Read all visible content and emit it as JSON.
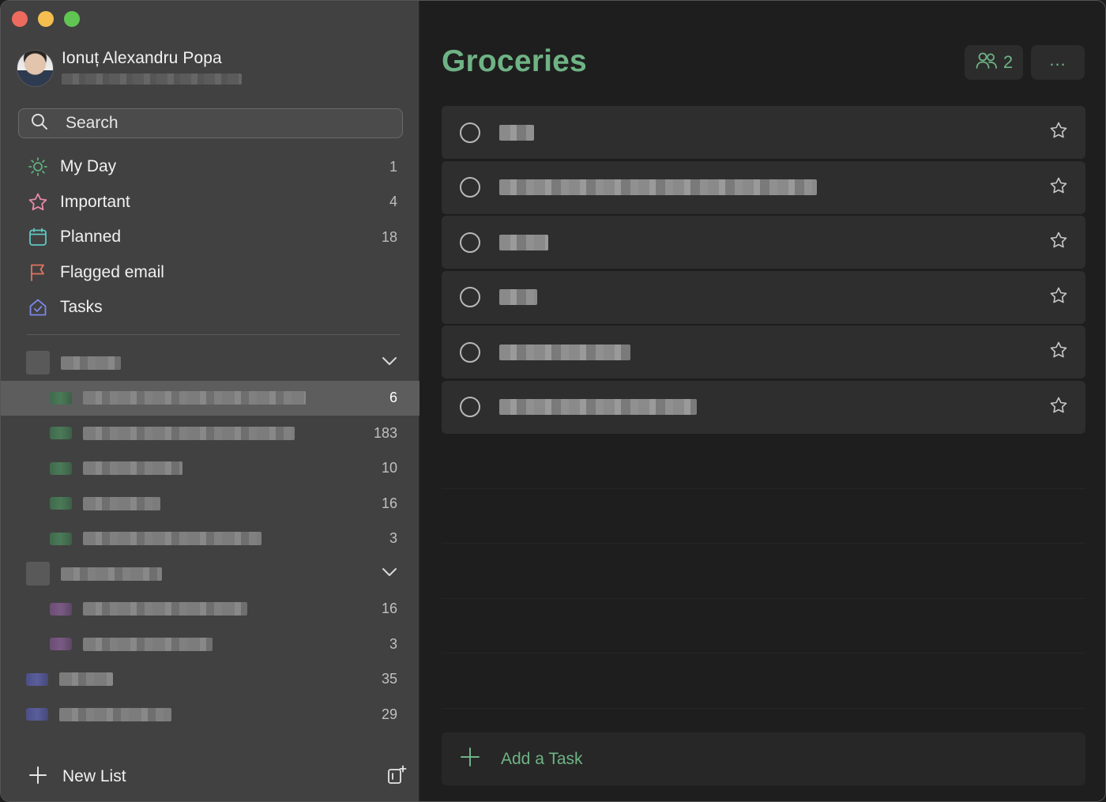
{
  "window": {
    "controls": [
      "close",
      "minimize",
      "maximize"
    ]
  },
  "profile": {
    "name": "Ionuț Alexandru Popa"
  },
  "search": {
    "placeholder": "Search"
  },
  "nav": [
    {
      "label": "My Day",
      "count": "1",
      "icon": "sun-icon",
      "color": "#5fb07f"
    },
    {
      "label": "Important",
      "count": "4",
      "icon": "star-icon",
      "color": "#e88aa8"
    },
    {
      "label": "Planned",
      "count": "18",
      "icon": "calendar-icon",
      "color": "#5fc7c0"
    },
    {
      "label": "Flagged email",
      "count": "",
      "icon": "flag-icon",
      "color": "#e0735f"
    },
    {
      "label": "Tasks",
      "count": "",
      "icon": "home-icon",
      "color": "#7c87e6"
    }
  ],
  "lists": [
    {
      "kind": "group",
      "count": "",
      "expanded": true
    },
    {
      "kind": "child",
      "count": "6",
      "selected": true,
      "color": "green"
    },
    {
      "kind": "child",
      "count": "183",
      "color": "green"
    },
    {
      "kind": "child",
      "count": "10",
      "color": "green"
    },
    {
      "kind": "child",
      "count": "16",
      "color": "green"
    },
    {
      "kind": "child",
      "count": "3",
      "color": "green"
    },
    {
      "kind": "group",
      "count": "",
      "expanded": true
    },
    {
      "kind": "child",
      "count": "16",
      "color": "purple"
    },
    {
      "kind": "child",
      "count": "3",
      "color": "purple"
    },
    {
      "kind": "top",
      "count": "35",
      "color": "blue"
    },
    {
      "kind": "top",
      "count": "29",
      "color": "blue"
    }
  ],
  "footer": {
    "new_list_label": "New List"
  },
  "main": {
    "title": "Groceries",
    "shared_count": "2",
    "more_label": "...",
    "add_task_label": "Add a Task",
    "accent": "#6fb385",
    "task_count": 6
  }
}
